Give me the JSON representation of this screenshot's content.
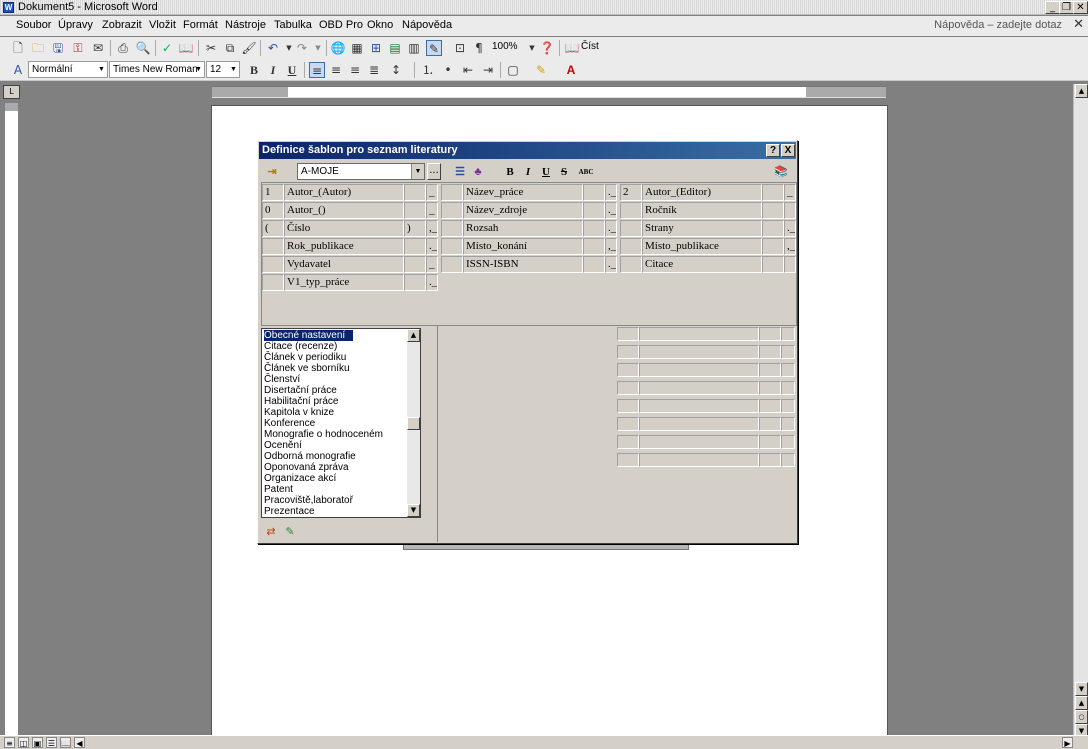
{
  "window": {
    "title": "Dokument5 - Microsoft Word"
  },
  "menu": {
    "items": [
      "Soubor",
      "Úpravy",
      "Zobrazit",
      "Vložit",
      "Formát",
      "Nástroje",
      "Tabulka",
      "OBD Pro",
      "Okno",
      "Nápověda"
    ],
    "help_placeholder": "Nápověda – zadejte dotaz"
  },
  "toolbar": {
    "zoom": "100%",
    "read_label": "Číst",
    "style": "Normální",
    "font": "Times New Roman",
    "font_size": "12",
    "bold": "B",
    "italic": "I",
    "underline": "U"
  },
  "dialog": {
    "title": "Definice šablon pro seznam literatury",
    "help_btn": "?",
    "close_btn": "X",
    "template": "A-MOJE",
    "ellipsis": "...",
    "fmt": {
      "bold": "B",
      "italic": "I",
      "underline": "U",
      "strike": "S",
      "abc": "ABC"
    },
    "fields": [
      {
        "pre": "1",
        "name": "Autor_(Autor)",
        "post": "",
        "sep": "_"
      },
      {
        "pre": "0",
        "name": "Autor_()",
        "post": "",
        "sep": "_"
      },
      {
        "pre": "(",
        "name": "Číslo",
        "post": ")",
        "sep": ",_"
      },
      {
        "pre": "",
        "name": "Rok_publikace",
        "post": "",
        "sep": "._"
      },
      {
        "pre": "",
        "name": "Vydavatel",
        "post": "",
        "sep": "_"
      },
      {
        "pre": "",
        "name": "V1_typ_práce",
        "post": "",
        "sep": "._"
      },
      {
        "pre": "",
        "name": "Název_práce",
        "post": "",
        "sep": "._"
      },
      {
        "pre": "",
        "name": "Název_zdroje",
        "post": "",
        "sep": "._"
      },
      {
        "pre": "",
        "name": "Rozsah",
        "post": "",
        "sep": "._"
      },
      {
        "pre": "",
        "name": "Místo_konání",
        "post": "",
        "sep": ",_"
      },
      {
        "pre": "",
        "name": "ISSN-ISBN",
        "post": "",
        "sep": "._("
      },
      {
        "pre": "2",
        "name": "Autor_(Editor)",
        "post": "",
        "sep": "_"
      },
      {
        "pre": "",
        "name": "Ročník",
        "post": "",
        "sep": ""
      },
      {
        "pre": "",
        "name": "Strany",
        "post": "",
        "sep": "._"
      },
      {
        "pre": "",
        "name": "Místo_publikace",
        "post": "",
        "sep": ",_"
      },
      {
        "pre": "",
        "name": "Citace",
        "post": "",
        "sep": ""
      }
    ],
    "list_items": [
      "Obecné nastavení",
      "Citace (recenze)",
      "Článek v periodiku",
      "Článek ve sborníku",
      "Členství",
      "Disertační práce",
      "Habilitační práce",
      "Kapitola v knize",
      "Konference",
      "Monografie o hodnoceném",
      "Ocenění",
      "Odborná monografie",
      "Oponovaná zpráva",
      "Organizace akcí",
      "Patent",
      "Pracoviště,laboratoř",
      "Prezentace"
    ]
  },
  "colors": {
    "title_start": "#0a246a",
    "title_end": "#3a6ea5",
    "dialog_bg": "#d4d0c8"
  }
}
